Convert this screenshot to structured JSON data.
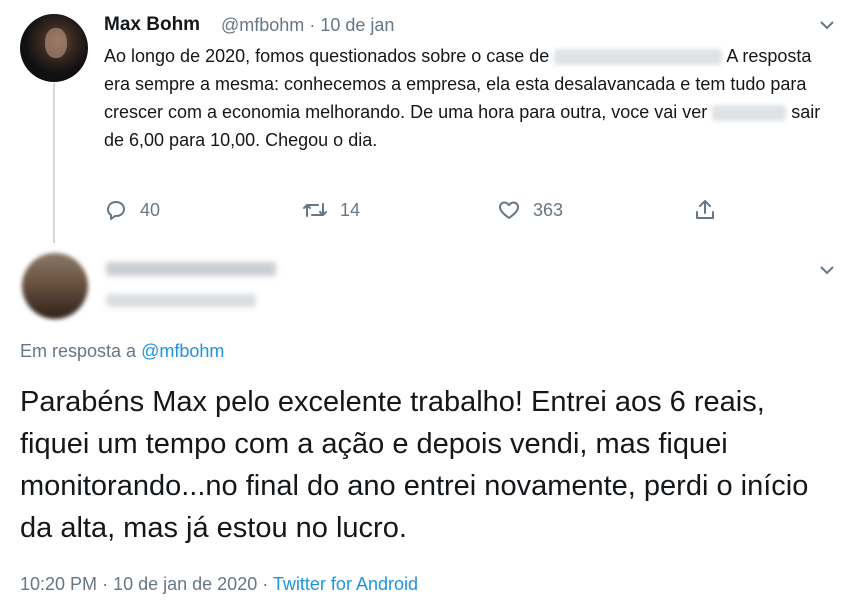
{
  "tweet": {
    "author_name": "Max Bohm",
    "author_handle": "@mfbohm",
    "separator": "·",
    "date": "10 de jan",
    "text_part1": "Ao longo de 2020, fomos questionados sobre o case de ",
    "text_part2": " A resposta era sempre a mesma: conhecemos a empresa, ela esta desalavancada e tem tudo para crescer com a economia melhorando. De uma hora para outra, voce vai ver ",
    "text_part3": " sair de 6,00 para 10,00. Chegou o dia.",
    "actions": {
      "replies": "40",
      "retweets": "14",
      "likes": "363"
    },
    "icons": [
      "reply-icon",
      "retweet-icon",
      "like-icon",
      "share-icon",
      "chevron-down-icon"
    ]
  },
  "reply": {
    "replying_prefix": "Em resposta a ",
    "replying_to": "@mfbohm",
    "text": "Parabéns Max pelo excelente trabalho! Entrei aos 6 reais, fiquei um tempo com a ação e depois vendi, mas fiquei monitorando...no final do ano entrei novamente, perdi o início da alta, mas já estou no lucro.",
    "time": "10:20 PM",
    "separator": "·",
    "date": "10 de jan de 2020",
    "separator2": "·",
    "source": "Twitter for Android"
  },
  "colors": {
    "text": "#14171a",
    "secondary": "#657786",
    "link": "#1b95e0",
    "thread_line": "#cfd9de"
  }
}
